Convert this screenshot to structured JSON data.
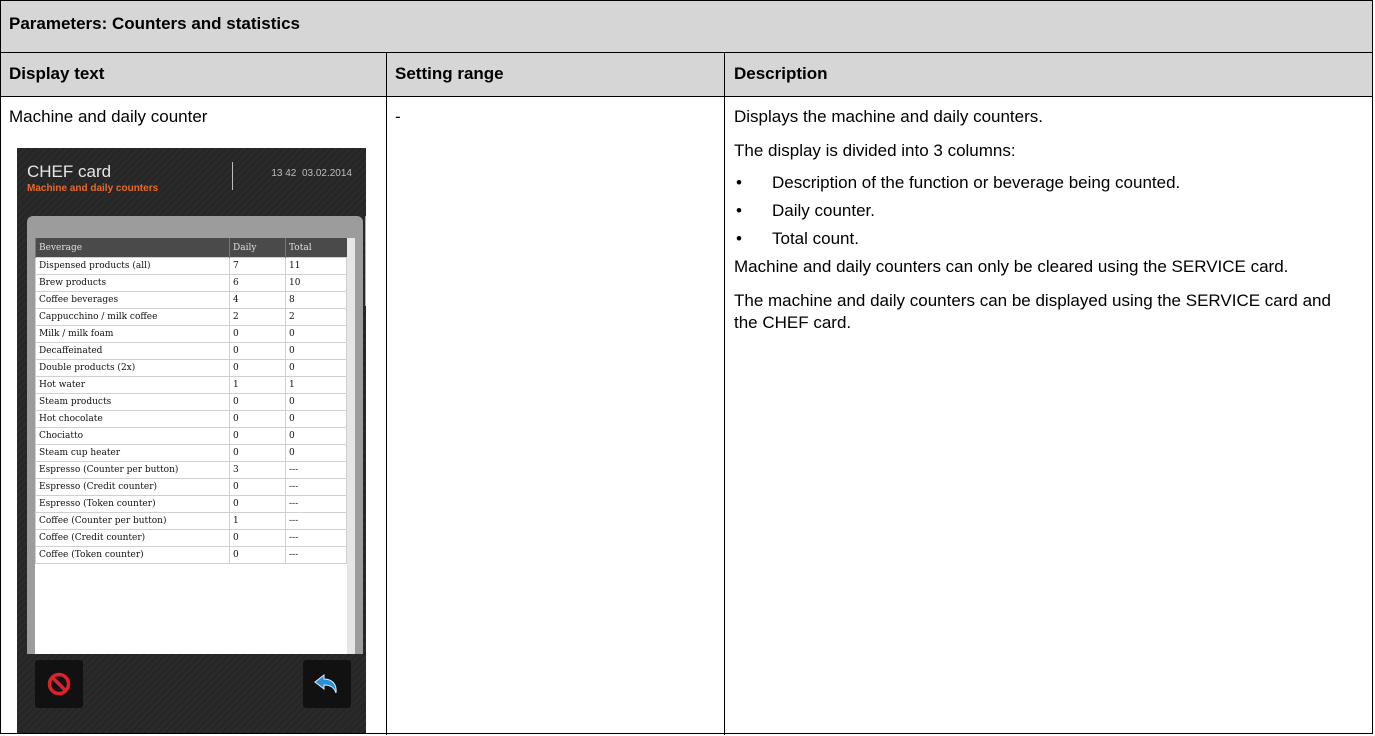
{
  "table": {
    "title": "Parameters: Counters and statistics",
    "headers": [
      "Display text",
      "Setting range",
      "Description"
    ]
  },
  "row": {
    "display_text": "Machine and daily counter",
    "setting_range": "-",
    "description": {
      "p1": "Displays the machine and daily counters.",
      "p2": "The display is divided into 3 columns:",
      "bullets": [
        "Description of the function or beverage being counted.",
        "Daily counter.",
        "Total count."
      ],
      "p3": "Machine and daily counters can only be cleared using the SERVICE card.",
      "p4": "The machine and daily counters can be displayed using the SERVICE card and the CHEF card."
    }
  },
  "screen": {
    "title": "CHEF card",
    "subtitle": "Machine and daily counters",
    "time": "13 42",
    "date": "03.02.2014",
    "columns": [
      "Beverage",
      "Daily",
      "Total"
    ],
    "rows": [
      [
        "Dispensed products (all)",
        "7",
        "11"
      ],
      [
        "Brew products",
        "6",
        "10"
      ],
      [
        "Coffee beverages",
        "4",
        "8"
      ],
      [
        "Cappucchino / milk coffee",
        "2",
        "2"
      ],
      [
        "Milk / milk foam",
        "0",
        "0"
      ],
      [
        "Decaffeinated",
        "0",
        "0"
      ],
      [
        "Double products (2x)",
        "0",
        "0"
      ],
      [
        "Hot water",
        "1",
        "1"
      ],
      [
        "Steam products",
        "0",
        "0"
      ],
      [
        "Hot chocolate",
        "0",
        "0"
      ],
      [
        "Chociatto",
        "0",
        "0"
      ],
      [
        "Steam cup heater",
        "0",
        "0"
      ],
      [
        "Espresso (Counter per button)",
        "3",
        "---"
      ],
      [
        "Espresso (Credit counter)",
        "0",
        "---"
      ],
      [
        "Espresso (Token counter)",
        "0",
        "---"
      ],
      [
        "Coffee (Counter per button)",
        "1",
        "---"
      ],
      [
        "Coffee (Credit counter)",
        "0",
        "---"
      ],
      [
        "Coffee (Token counter)",
        "0",
        "---"
      ]
    ],
    "icons": {
      "clear": "no-entry-icon",
      "back": "back-arrow-icon"
    },
    "colors": {
      "accent": "#e8692a",
      "scroll": "#9acd32",
      "icon_red": "#e0202a",
      "icon_blue": "#2a8fd6"
    }
  }
}
